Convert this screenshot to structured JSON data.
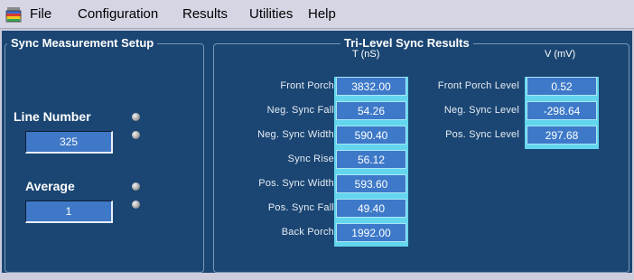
{
  "menu": {
    "file": "File",
    "configuration": "Configuration",
    "results": "Results",
    "utilities": "Utilities",
    "help": "Help"
  },
  "setup": {
    "title": "Sync Measurement Setup",
    "line_number_label": "Line Number",
    "line_number_value": "325",
    "average_label": "Average",
    "average_value": "1"
  },
  "results": {
    "title": "Tri-Level Sync Results",
    "time_unit_header": "T (nS)",
    "voltage_unit_header": "V (mV)",
    "timing": [
      {
        "label": "Front Porch",
        "value": "3832.00"
      },
      {
        "label": "Neg. Sync Fall",
        "value": "54.26"
      },
      {
        "label": "Neg. Sync Width",
        "value": "590.40"
      },
      {
        "label": "Sync Rise",
        "value": "56.12"
      },
      {
        "label": "Pos. Sync Width",
        "value": "593.60"
      },
      {
        "label": "Pos. Sync Fall",
        "value": "49.40"
      },
      {
        "label": "Back Porch",
        "value": "1992.00"
      }
    ],
    "levels": [
      {
        "label": "Front Porch Level",
        "value": "0.52"
      },
      {
        "label": "Neg. Sync Level",
        "value": "-298.64"
      },
      {
        "label": "Pos. Sync Level",
        "value": "297.68"
      }
    ]
  }
}
